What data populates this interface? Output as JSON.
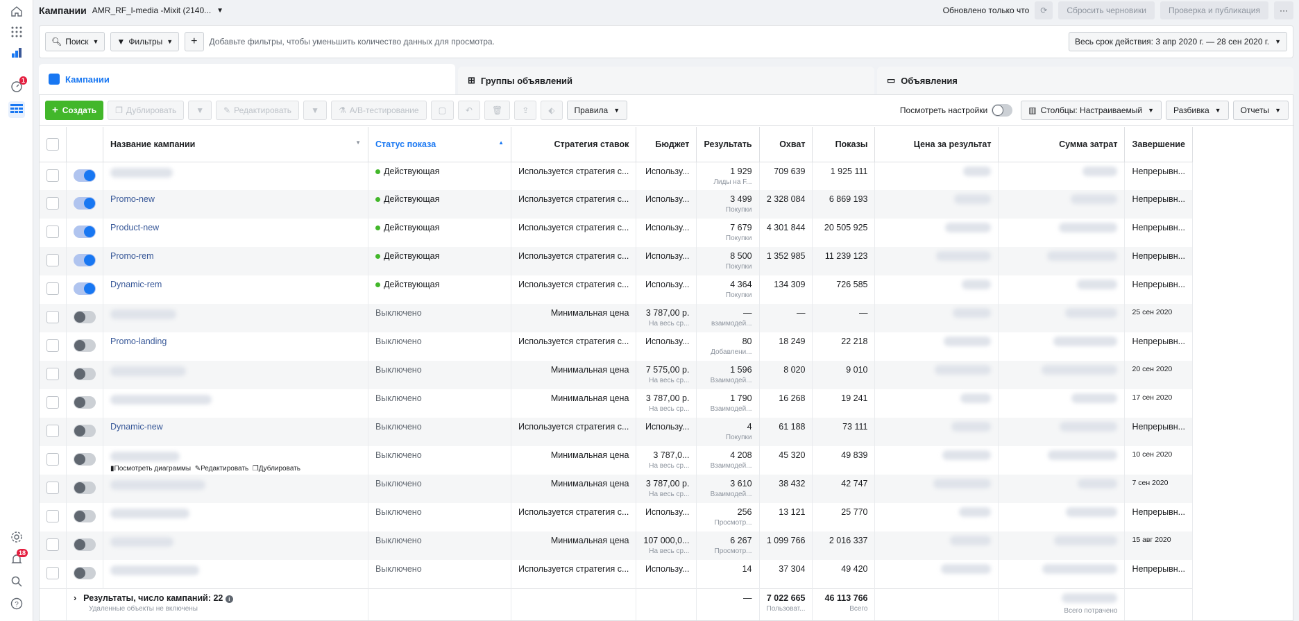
{
  "header": {
    "title": "Кампании",
    "account": "AMR_RF_l-media -Mixit (2140...",
    "updated": "Обновлено только что",
    "discard": "Сбросить черновики",
    "review": "Проверка и публикация",
    "more": "···"
  },
  "filters": {
    "search": "Поиск",
    "filters": "Фильтры",
    "hint": "Добавьте фильтры, чтобы уменьшить количество данных для просмотра.",
    "date": "Весь срок действия: 3 апр 2020 г. — 28 сен 2020 г."
  },
  "tabs": {
    "campaigns": "Кампании",
    "adsets": "Группы объявлений",
    "ads": "Объявления"
  },
  "toolbar": {
    "create": "Создать",
    "duplicate": "Дублировать",
    "edit": "Редактировать",
    "ab": "A/B-тестирование",
    "rules": "Правила",
    "view_settings": "Посмотреть настройки",
    "columns": "Столбцы: Настраиваемый",
    "breakdown": "Разбивка",
    "reports": "Отчеты"
  },
  "columns": [
    "Название кампании",
    "Статус показа",
    "Стратегия ставок",
    "Бюджет",
    "Результать",
    "Охват",
    "Показы",
    "Цена за результат",
    "Сумма затрат",
    "Завершение"
  ],
  "rows": [
    {
      "name": "",
      "on": true,
      "status": "Действующая",
      "active": true,
      "strategy": "Используется стратегия с...",
      "budget": "Использу...",
      "budget_sub": "",
      "result": "1 929",
      "result_sub": "Лиды на F...",
      "reach": "709 639",
      "impr": "1 925 111",
      "end": "Непрерывн..."
    },
    {
      "name": "Promo-new",
      "on": true,
      "status": "Действующая",
      "active": true,
      "strategy": "Используется стратегия с...",
      "budget": "Использу...",
      "budget_sub": "",
      "result": "3 499",
      "result_sub": "Покупки",
      "reach": "2 328 084",
      "impr": "6 869 193",
      "end": "Непрерывн..."
    },
    {
      "name": "Product-new",
      "on": true,
      "status": "Действующая",
      "active": true,
      "strategy": "Используется стратегия с...",
      "budget": "Использу...",
      "budget_sub": "",
      "result": "7 679",
      "result_sub": "Покупки",
      "reach": "4 301 844",
      "impr": "20 505 925",
      "end": "Непрерывн..."
    },
    {
      "name": "Promo-rem",
      "on": true,
      "status": "Действующая",
      "active": true,
      "strategy": "Используется стратегия с...",
      "budget": "Использу...",
      "budget_sub": "",
      "result": "8 500",
      "result_sub": "Покупки",
      "reach": "1 352 985",
      "impr": "11 239 123",
      "end": "Непрерывн..."
    },
    {
      "name": "Dynamic-rem",
      "on": true,
      "status": "Действующая",
      "active": true,
      "strategy": "Используется стратегия с...",
      "budget": "Использу...",
      "budget_sub": "",
      "result": "4 364",
      "result_sub": "Покупки",
      "reach": "134 309",
      "impr": "726 585",
      "end": "Непрерывн..."
    },
    {
      "name": "",
      "on": false,
      "status": "Выключено",
      "active": false,
      "strategy": "Минимальная цена",
      "budget": "3 787,00 р.",
      "budget_sub": "На весь ср...",
      "result": "—",
      "result_sub": "взаимодей...",
      "reach": "—",
      "impr": "—",
      "end": "25 сен 2020"
    },
    {
      "name": "Promo-landing",
      "on": false,
      "status": "Выключено",
      "active": false,
      "strategy": "Используется стратегия с...",
      "budget": "Использу...",
      "budget_sub": "",
      "result": "80",
      "result_sub": "Добавлени...",
      "reach": "18 249",
      "impr": "22 218",
      "end": "Непрерывн..."
    },
    {
      "name": "",
      "on": false,
      "status": "Выключено",
      "active": false,
      "strategy": "Минимальная цена",
      "budget": "7 575,00 р.",
      "budget_sub": "На весь ср...",
      "result": "1 596",
      "result_sub": "Взаимодей...",
      "reach": "8 020",
      "impr": "9 010",
      "end": "20 сен 2020"
    },
    {
      "name": "",
      "on": false,
      "status": "Выключено",
      "active": false,
      "strategy": "Минимальная цена",
      "budget": "3 787,00 р.",
      "budget_sub": "На весь ср...",
      "result": "1 790",
      "result_sub": "Взаимодей...",
      "reach": "16 268",
      "impr": "19 241",
      "end": "17 сен 2020"
    },
    {
      "name": "Dynamic-new",
      "on": false,
      "status": "Выключено",
      "active": false,
      "strategy": "Используется стратегия с...",
      "budget": "Использу...",
      "budget_sub": "",
      "result": "4",
      "result_sub": "Покупки",
      "reach": "61 188",
      "impr": "73 111",
      "end": "Непрерывн..."
    },
    {
      "name": "",
      "on": false,
      "status": "Выключено",
      "active": false,
      "strategy": "Минимальная цена",
      "budget": "3 787,0...",
      "budget_sub": "На весь ср...",
      "result": "4 208",
      "result_sub": "Взаимодей...",
      "reach": "45 320",
      "impr": "49 839",
      "end": "10 сен 2020",
      "hover": true
    },
    {
      "name": "",
      "on": false,
      "status": "Выключено",
      "active": false,
      "strategy": "Минимальная цена",
      "budget": "3 787,00 р.",
      "budget_sub": "На весь ср...",
      "result": "3 610",
      "result_sub": "Взаимодей...",
      "reach": "38 432",
      "impr": "42 747",
      "end": "7 сен 2020"
    },
    {
      "name": "",
      "on": false,
      "status": "Выключено",
      "active": false,
      "strategy": "Используется стратегия с...",
      "budget": "Использу...",
      "budget_sub": "",
      "result": "256",
      "result_sub": "Просмотр...",
      "reach": "13 121",
      "impr": "25 770",
      "end": "Непрерывн..."
    },
    {
      "name": "",
      "on": false,
      "status": "Выключено",
      "active": false,
      "strategy": "Минимальная цена",
      "budget": "107 000,0...",
      "budget_sub": "На весь ср...",
      "result": "6 267",
      "result_sub": "Просмотр...",
      "reach": "1 099 766",
      "impr": "2 016 337",
      "end": "15 авг 2020"
    },
    {
      "name": "",
      "on": false,
      "status": "Выключено",
      "active": false,
      "strategy": "Используется стратегия с...",
      "budget": "Использу...",
      "budget_sub": "",
      "result": "14",
      "result_sub": "",
      "reach": "37 304",
      "impr": "49 420",
      "end": "Непрерывн..."
    }
  ],
  "hover_actions": {
    "charts": "Посмотреть диаграммы",
    "edit": "Редактировать",
    "duplicate": "Дублировать"
  },
  "footer": {
    "label": "Результаты, число кампаний: 22",
    "sub": "Удаленные объекты не включены",
    "result": "—",
    "reach": "7 022 665",
    "reach_sub": "Пользоват...",
    "impr": "46 113 766",
    "impr_sub": "Всего",
    "spent_sub": "Всего потрачено"
  },
  "rail_badges": {
    "notif1": "1",
    "notif2": "18"
  }
}
